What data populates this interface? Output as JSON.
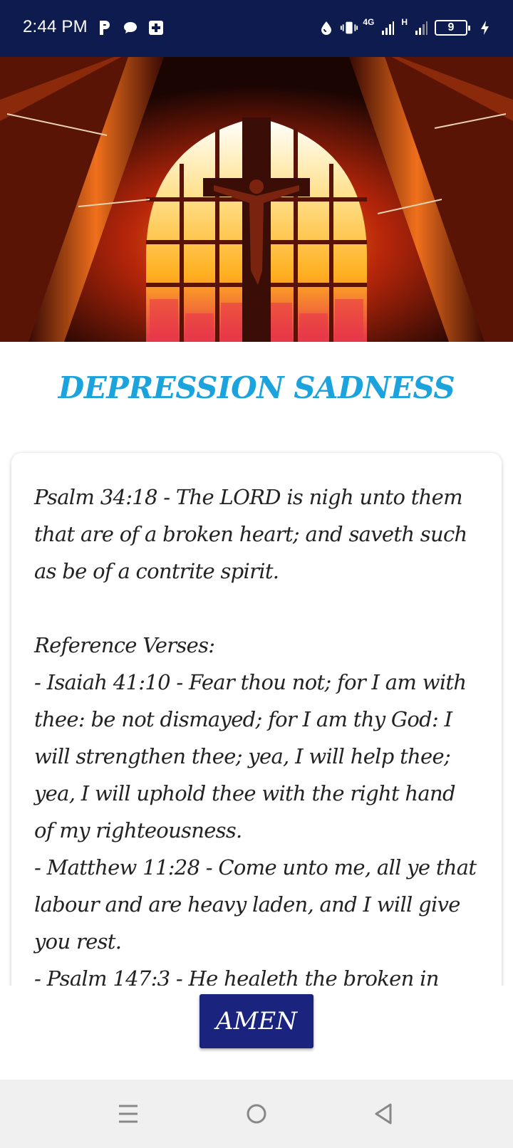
{
  "status_bar": {
    "time": "2:44 PM",
    "left_icons": [
      "parking-icon",
      "chat-bubble-icon",
      "medical-plus-icon"
    ],
    "network_1": "4G",
    "network_2": "H",
    "battery_level": "9"
  },
  "hero": {
    "image": "church-stained-glass-crucifix"
  },
  "title": "DEPRESSION SADNESS",
  "content": {
    "text": "Psalm 34:18 - The LORD is nigh unto them that are of a broken heart; and saveth such as be of a contrite spirit.\n\nReference Verses:\n- Isaiah 41:10 - Fear thou not; for I am with thee: be not dismayed; for I am thy God: I will strengthen thee; yea, I will help thee; yea, I will uphold thee with the right hand of my righteousness.\n- Matthew 11:28 - Come unto me, all ye that labour and are heavy laden, and I will give you rest.\n- Psalm 147:3 - He healeth the broken in"
  },
  "amen_button": "AMEN",
  "nav": [
    "menu-icon",
    "home-icon",
    "back-icon"
  ],
  "colors": {
    "status_bar": "#0d1b4f",
    "title": "#1aa3dc",
    "button": "#1a237e",
    "nav_bar": "#f0f0f0"
  }
}
